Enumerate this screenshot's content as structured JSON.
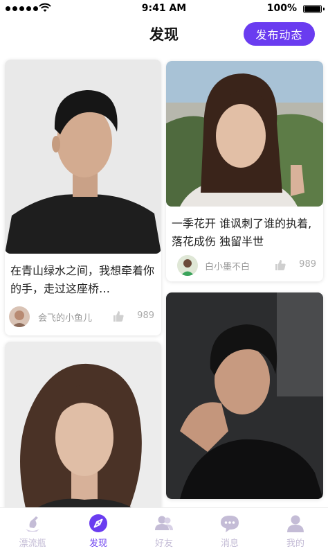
{
  "status_bar": {
    "time": "9:41 AM",
    "battery": "100%"
  },
  "header": {
    "title": "发现",
    "publish_label": "发布动态"
  },
  "feed": [
    {
      "text": "在青山绿水之间，我想牵着你的手，走过这座桥…",
      "author": "会飞的小鱼儿",
      "likes": "989"
    },
    {
      "text": "一季花开 谁讽刺了谁的执着, 落花成伤 独留半世",
      "author": "白小墨不白",
      "likes": "989"
    },
    {
      "text": "",
      "author": "",
      "likes": ""
    },
    {
      "text": "",
      "author": "",
      "likes": ""
    }
  ],
  "tabs": [
    {
      "label": "漂流瓶",
      "icon": "bottle-icon"
    },
    {
      "label": "发现",
      "icon": "compass-icon",
      "active": true
    },
    {
      "label": "好友",
      "icon": "friends-icon"
    },
    {
      "label": "消息",
      "icon": "message-icon"
    },
    {
      "label": "我的",
      "icon": "user-icon"
    }
  ],
  "colors": {
    "accent": "#6a3cf0",
    "inactive_tab": "#c4bcd6",
    "meta_text": "#999999"
  }
}
